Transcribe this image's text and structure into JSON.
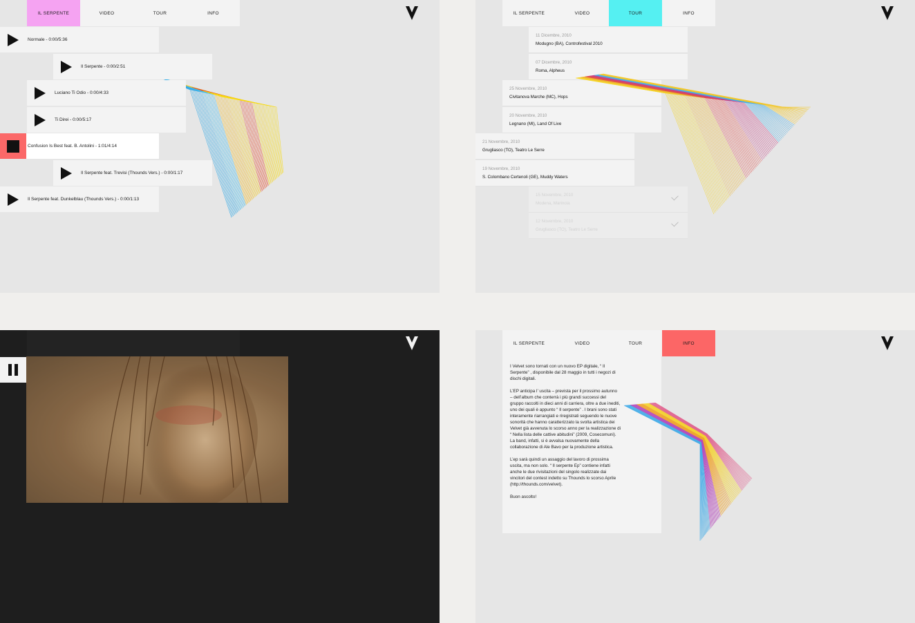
{
  "nav": {
    "tabs": [
      "IL SERPENTE",
      "VIDEO",
      "TOUR",
      "INFO"
    ]
  },
  "colors": {
    "serpente_active": "#f5a3f2",
    "tour_active": "#55f0f2",
    "info_active": "#fc6666",
    "stop_button": "#fb6868",
    "panel_bg": "#e6e6e6",
    "video_bg": "#1e1e1e"
  },
  "icons": {
    "logo": "v-logo-icon",
    "play": "play-icon",
    "stop": "stop-icon",
    "pause": "pause-icon",
    "check": "check-icon"
  },
  "tracks": [
    {
      "label": "Normale - 0:00/5:36",
      "state": "paused"
    },
    {
      "label": "Il Serpente - 0:00/2:51",
      "state": "paused"
    },
    {
      "label": "Luciano Ti Odio - 0:00/4:33",
      "state": "paused"
    },
    {
      "label": "Ti Direi - 0:00/5:17",
      "state": "paused"
    },
    {
      "label": "Confusion Is Best feat. B. Antolini - 1:01/4:14",
      "state": "playing"
    },
    {
      "label": "Il Serpente feat. Trevisi (Thounds Vers.) - 0:00/1:17",
      "state": "paused"
    },
    {
      "label": "Il Serpente feat. Dunkelblau (Thounds Vers.) - 0:00/1:13",
      "state": "paused"
    }
  ],
  "tour": [
    {
      "date": "11 Dicembre, 2010",
      "venue": "Modugno (BA), Controfestival 2010",
      "past": false
    },
    {
      "date": "07 Dicembre, 2010",
      "venue": "Roma, Alpheus",
      "past": false
    },
    {
      "date": "25 Novembre, 2010",
      "venue": "Civitanova Marche (MC), Hops",
      "past": false
    },
    {
      "date": "20 Novembre, 2010",
      "venue": "Legnano (MI), Land Of Live",
      "past": false
    },
    {
      "date": "21 Novembre, 2010",
      "venue": "Grugliasco (TO), Teatro Le Serre",
      "past": false
    },
    {
      "date": "19 Novembre, 2010",
      "venue": "S. Colombano Certenoli (GE), Muddy Waters",
      "past": false
    },
    {
      "date": "15 Novembre, 2010",
      "venue": "Modena, Marinoia",
      "past": true
    },
    {
      "date": "12 Novembre, 2010",
      "venue": "Grugliasco (TO), Teatro Le Serre",
      "past": true
    }
  ],
  "info": {
    "paragraphs": [
      "I Velvet sono tornati con un nuovo EP digitale, “ Il Serpente” , disponibile dal 28 maggio in tutti i negozi di dischi digitali.",
      "L’EP anticipa l’ uscita – prevista per il prossimo autunno – dell’album che conterrà i più grandi successi del gruppo raccolti in dieci anni di carriera, oltre a due inediti, uno dei quali è appunto “ Il serpente” . I brani sono stati interamente riarrangiati e riregistrati seguendo le nuove sonorità che hanno caratterizzato la svolta artistica dei Velvet già avvenuta lo scorso anno per la realizzazione di “ Nella lista delle cattive abitudini” (2009, Cosecomuni). La band, infatti, si è avvalsa nuovamente della collaborazione di Ale Bavo per la produzione artistica.",
      "L’ep sarà quindi un assaggio del lavoro di prossima uscita, ma non solo. “ Il serpente Ep” contiene infatti anche le due rivisitazioni del singolo realizzate dai vincitori del contest indetto su Thounds lo scorso Aprile (http://thounds.com/velvet).",
      "Buon ascolto!"
    ]
  }
}
